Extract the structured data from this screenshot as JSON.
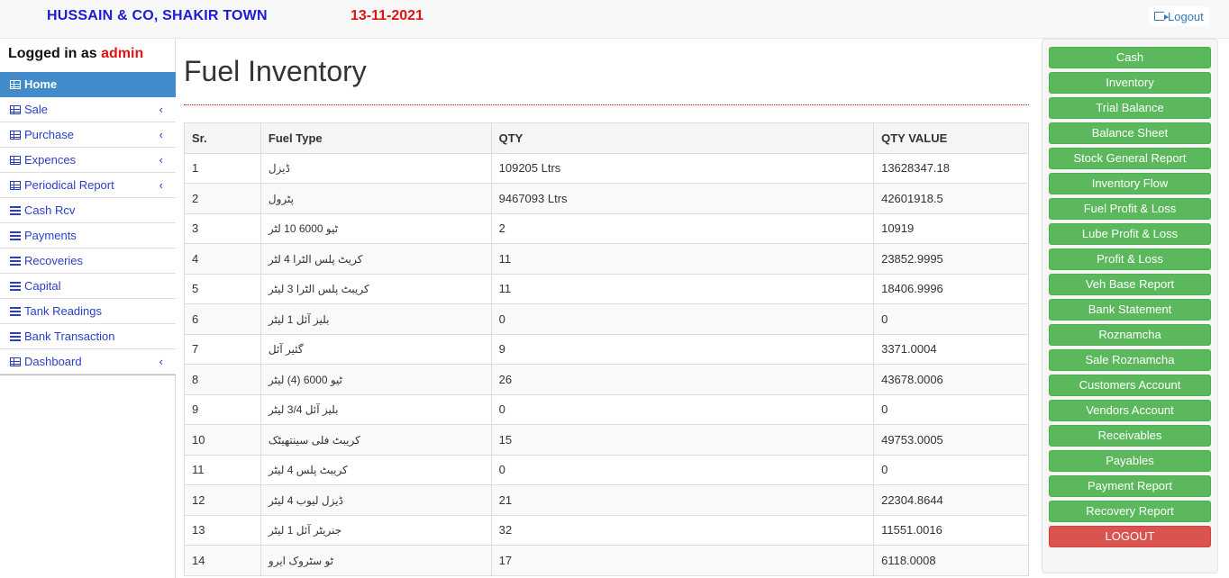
{
  "header": {
    "brand": "HUSSAIN & CO, SHAKIR TOWN",
    "date": "13-11-2021",
    "logout_label": "Logout"
  },
  "sidebar": {
    "logged_prefix": "Logged in as",
    "username": "admin",
    "items": [
      {
        "label": "Home",
        "icon": "table-icon",
        "active": true,
        "chevron": false
      },
      {
        "label": "Sale",
        "icon": "table-icon",
        "chevron": true
      },
      {
        "label": "Purchase",
        "icon": "table-icon",
        "chevron": true
      },
      {
        "label": "Expences",
        "icon": "table-icon",
        "chevron": true
      },
      {
        "label": "Periodical Report",
        "icon": "table-icon",
        "chevron": true
      },
      {
        "label": "Cash Rcv",
        "icon": "list-icon",
        "chevron": false
      },
      {
        "label": "Payments",
        "icon": "list-icon",
        "chevron": false
      },
      {
        "label": "Recoveries",
        "icon": "list-icon",
        "chevron": false
      },
      {
        "label": "Capital",
        "icon": "list-icon",
        "chevron": false
      },
      {
        "label": "Tank Readings",
        "icon": "list-icon",
        "chevron": false
      },
      {
        "label": "Bank Transaction",
        "icon": "list-icon",
        "chevron": false
      },
      {
        "label": "Dashboard",
        "icon": "table-icon",
        "chevron": true
      }
    ],
    "chevron_glyph": "‹"
  },
  "main": {
    "title": "Fuel Inventory",
    "columns": [
      "Sr.",
      "Fuel Type",
      "QTY",
      "QTY VALUE"
    ],
    "rows": [
      [
        "1",
        "ڈیزل",
        "109205 Ltrs",
        "13628347.18"
      ],
      [
        "2",
        "پٹرول",
        "9467093 Ltrs",
        "42601918.5"
      ],
      [
        "3",
        "ٹیو 6000 10 لٹر",
        "2",
        "10919"
      ],
      [
        "4",
        "کریٹ پلس الٹرا 4 لٹر",
        "11",
        "23852.9995"
      ],
      [
        "5",
        "کریبٹ پلس الٹرا 3 لیٹر",
        "11",
        "18406.9996"
      ],
      [
        "6",
        "بلیز آئل 1 لیٹر",
        "0",
        "0"
      ],
      [
        "7",
        "گئیر آئل",
        "9",
        "3371.0004"
      ],
      [
        "8",
        "ٹیو 6000 (4) لیٹر",
        "26",
        "43678.0006"
      ],
      [
        "9",
        "بلیز آئل 3/4 لیٹر",
        "0",
        "0"
      ],
      [
        "10",
        "کریبٹ فلی سینتھیٹک",
        "15",
        "49753.0005"
      ],
      [
        "11",
        "کریبٹ پلس 4 لیٹر",
        "0",
        "0"
      ],
      [
        "12",
        "ڈیزل لیوب 4 لیٹر",
        "21",
        "22304.8644"
      ],
      [
        "13",
        "جنریٹر آئل 1 لیٹر",
        "32",
        "11551.0016"
      ],
      [
        "14",
        "ٹو سٹروک ایرو",
        "17",
        "6118.0008"
      ]
    ]
  },
  "right_panel": {
    "buttons": [
      "Cash",
      "Inventory",
      "Trial Balance",
      "Balance Sheet",
      "Stock General Report",
      "Inventory Flow",
      "Fuel Profit & Loss",
      "Lube Profit & Loss",
      "Profit & Loss",
      "Veh Base Report",
      "Bank Statement",
      "Roznamcha",
      "Sale Roznamcha",
      "Customers Account",
      "Vendors Account",
      "Receivables",
      "Payables",
      "Payment Report",
      "Recovery Report"
    ],
    "logout_button": "LOGOUT"
  },
  "colors": {
    "brand": "#1c1cd4",
    "date": "#e01414",
    "active_nav": "#428bca",
    "green_button": "#5cb85c",
    "red_button": "#d9534f"
  }
}
